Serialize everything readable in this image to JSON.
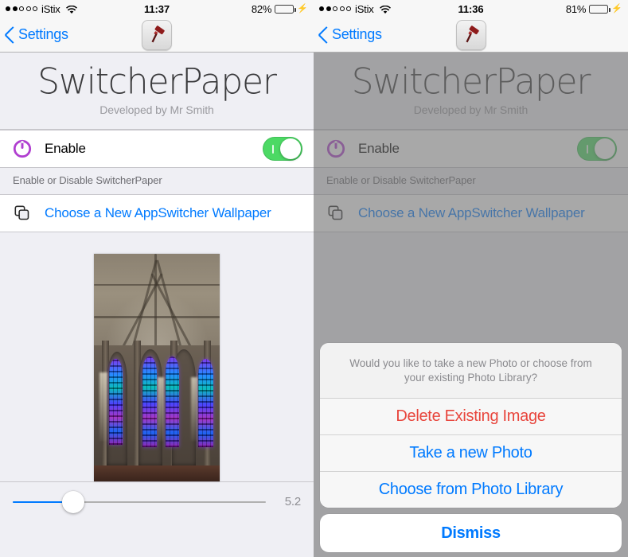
{
  "panels": [
    {
      "id": "left",
      "status": {
        "carrier": "iStix",
        "signal_dots_filled": 2,
        "signal_dots_total": 5,
        "wifi_icon": "wifi-icon",
        "time": "11:37",
        "battery_percent": "82%",
        "battery_level": 82,
        "charging_icon": "lightning-bolt-icon"
      },
      "nav": {
        "back_label": "Settings",
        "back_icon": "chevron-left-icon",
        "app_icon": "paint-roller-icon"
      },
      "header": {
        "title": "SwitcherPaper",
        "subtitle": "Developed by Mr Smith"
      },
      "enable_cell": {
        "icon": "power-icon",
        "label": "Enable",
        "toggle_on": true,
        "footer": "Enable or Disable SwitcherPaper"
      },
      "wallpaper_cell": {
        "icon": "copy-layers-icon",
        "label": "Choose a New AppSwitcher Wallpaper"
      },
      "preview": {
        "alt": "cathedral-interior-stained-glass"
      },
      "slider": {
        "value_label": "5.2",
        "value": 5.2,
        "min": 0,
        "max": 20,
        "fill_percent": 24
      },
      "dialog": null
    },
    {
      "id": "right",
      "status": {
        "carrier": "iStix",
        "signal_dots_filled": 2,
        "signal_dots_total": 5,
        "wifi_icon": "wifi-icon",
        "time": "11:36",
        "battery_percent": "81%",
        "battery_level": 81,
        "charging_icon": "lightning-bolt-icon"
      },
      "nav": {
        "back_label": "Settings",
        "back_icon": "chevron-left-icon",
        "app_icon": "paint-roller-icon"
      },
      "header": {
        "title": "SwitcherPaper",
        "subtitle": "Developed by Mr Smith"
      },
      "enable_cell": {
        "icon": "power-icon",
        "label": "Enable",
        "toggle_on": true,
        "footer": "Enable or Disable SwitcherPaper"
      },
      "wallpaper_cell": {
        "icon": "copy-layers-icon",
        "label": "Choose a New AppSwitcher Wallpaper"
      },
      "preview": null,
      "slider": null,
      "dialog": {
        "message": "Would you like to take a new Photo or choose from your existing Photo Library?",
        "buttons": [
          {
            "label": "Delete Existing Image",
            "style": "destructive"
          },
          {
            "label": "Take a new Photo",
            "style": "default"
          },
          {
            "label": "Choose from Photo Library",
            "style": "default"
          }
        ],
        "cancel": {
          "label": "Dismiss",
          "style": "cancel"
        }
      }
    }
  ],
  "colors": {
    "tint_blue": "#007aff",
    "destructive_red": "#e8453c",
    "toggle_green": "#4cd964",
    "power_purple": "#b03fd0",
    "group_bg": "#efeff4",
    "dim_overlay": "#737373"
  }
}
